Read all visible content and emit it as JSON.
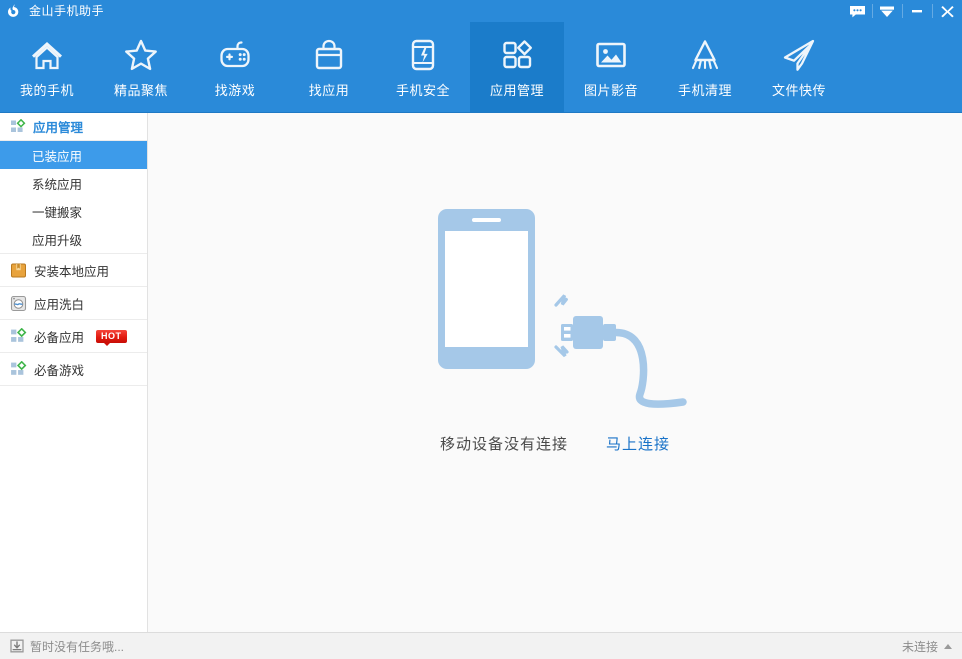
{
  "window": {
    "title": "金山手机助手",
    "logo_icon": "kingsoft-logo-icon",
    "controls": [
      {
        "name": "feedback-button",
        "icon": "message-bubble-icon",
        "label": ""
      },
      {
        "name": "downloads-button",
        "icon": "download-arrow-icon",
        "label": ""
      },
      {
        "name": "minimize-button",
        "icon": "minimize-icon",
        "label": ""
      },
      {
        "name": "close-button",
        "icon": "close-icon",
        "label": ""
      }
    ]
  },
  "nav": {
    "active_index": 5,
    "items": [
      {
        "label": "我的手机",
        "icon": "home-icon"
      },
      {
        "label": "精品聚焦",
        "icon": "star-icon"
      },
      {
        "label": "找游戏",
        "icon": "gamepad-icon"
      },
      {
        "label": "找应用",
        "icon": "shopping-bag-icon"
      },
      {
        "label": "手机安全",
        "icon": "phone-shield-icon"
      },
      {
        "label": "应用管理",
        "icon": "app-grid-icon"
      },
      {
        "label": "图片影音",
        "icon": "picture-icon"
      },
      {
        "label": "手机清理",
        "icon": "broom-icon"
      },
      {
        "label": "文件快传",
        "icon": "paper-plane-icon"
      }
    ]
  },
  "sidebar": {
    "group": {
      "title": "应用管理",
      "icon": "app-grid-small-icon",
      "items": [
        {
          "label": "已装应用",
          "selected": true
        },
        {
          "label": "系统应用",
          "selected": false
        },
        {
          "label": "一键搬家",
          "selected": false
        },
        {
          "label": "应用升级",
          "selected": false
        }
      ]
    },
    "rows": [
      {
        "label": "安装本地应用",
        "icon": "package-box-icon",
        "badge": ""
      },
      {
        "label": "应用洗白",
        "icon": "washer-icon",
        "badge": ""
      },
      {
        "label": "必备应用",
        "icon": "app-grid-small-icon",
        "badge": "HOT"
      },
      {
        "label": "必备游戏",
        "icon": "app-grid-small-icon",
        "badge": ""
      }
    ]
  },
  "content": {
    "illustration": "disconnected-phone-usb-illustration",
    "empty_message": "移动设备没有连接",
    "connect_link": "马上连接"
  },
  "statusbar": {
    "task_icon": "download-tray-icon",
    "task_text": "暂时没有任务哦...",
    "connection_text": "未连接",
    "caret_icon": "caret-up-icon"
  },
  "colors": {
    "brand_blue": "#2a8ad9",
    "active_tab_blue": "#1b7cca",
    "selected_item_blue": "#3d9bea",
    "link_blue": "#1a73c8",
    "illustration_blue": "#a5c8e8",
    "hot_red": "#e21b10"
  }
}
